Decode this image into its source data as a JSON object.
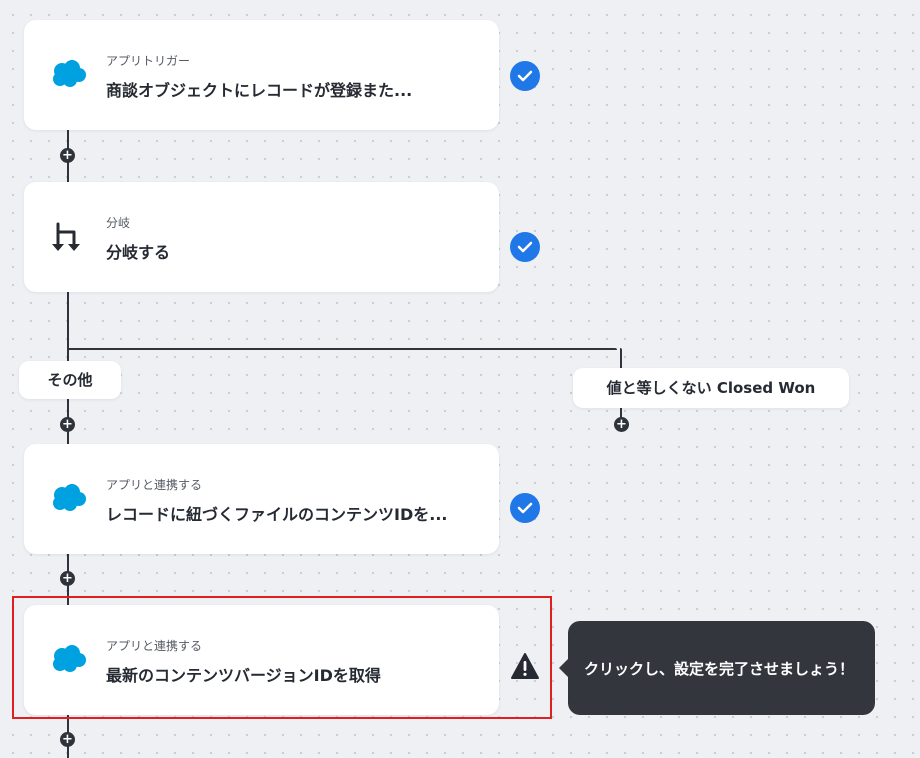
{
  "icons": {
    "salesforce": "salesforce-cloud-icon",
    "branch": "branch-icon",
    "check": "check-icon",
    "warning": "warning-icon",
    "add": "add-step-icon"
  },
  "colors": {
    "salesforce": "#00a1e0",
    "check": "#1f77e8",
    "highlight": "#e02020",
    "tooltip": "#33363d"
  },
  "flow": {
    "trigger": {
      "label": "アプリトリガー",
      "title": "商談オブジェクトにレコードが登録また..."
    },
    "branch": {
      "label": "分岐",
      "title": "分岐する"
    },
    "branch_labels": {
      "other": "その他",
      "condition": "値と等しくない Closed Won"
    },
    "step_files": {
      "label": "アプリと連携する",
      "title": "レコードに紐づくファイルのコンテンツIDを..."
    },
    "step_version": {
      "label": "アプリと連携する",
      "title": "最新のコンテンツバージョンIDを取得"
    },
    "add_symbol": "+"
  },
  "tooltip": {
    "text": "クリックし、設定を完了させましょう！"
  }
}
